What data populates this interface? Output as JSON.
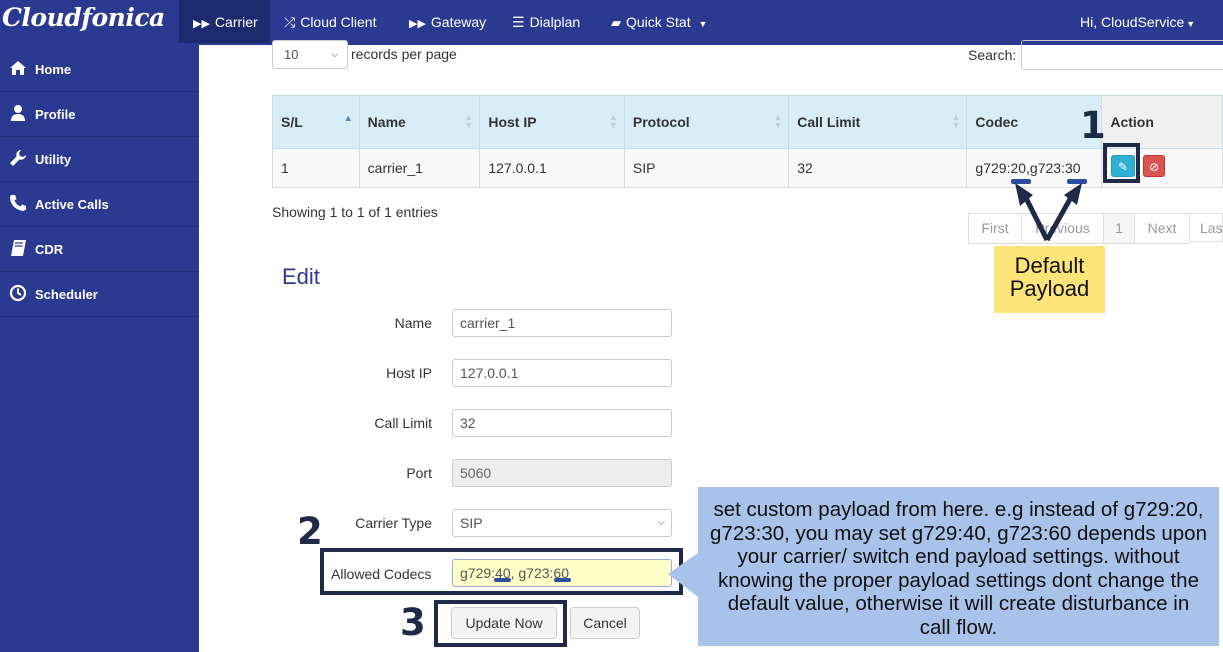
{
  "brand": "Cloudfonica",
  "nav": {
    "items": [
      {
        "label": "Carrier",
        "icon": "double-chevron-right-icon"
      },
      {
        "label": "Cloud Client",
        "icon": "shuffle-icon"
      },
      {
        "label": "Gateway",
        "icon": "double-chevron-right-icon"
      },
      {
        "label": "Dialplan",
        "icon": "list-icon"
      },
      {
        "label": "Quick Stat",
        "icon": "book-icon"
      }
    ],
    "user": "Hi, CloudService"
  },
  "sidebar": {
    "items": [
      {
        "label": "Home",
        "icon": "home-icon"
      },
      {
        "label": "Profile",
        "icon": "user-icon"
      },
      {
        "label": "Utility",
        "icon": "wrench-icon"
      },
      {
        "label": "Active Calls",
        "icon": "phone-icon"
      },
      {
        "label": "CDR",
        "icon": "book-icon"
      },
      {
        "label": "Scheduler",
        "icon": "clock-icon"
      }
    ]
  },
  "table_controls": {
    "page_size": "10",
    "records_per_page": "records per page",
    "search_label": "Search:",
    "search_value": ""
  },
  "table": {
    "headers": [
      "S/L",
      "Name",
      "Host IP",
      "Protocol",
      "Call Limit",
      "Codec",
      "Action"
    ],
    "rows": [
      {
        "sl": "1",
        "name": "carrier_1",
        "host_ip": "127.0.0.1",
        "protocol": "SIP",
        "call_limit": "32",
        "codec": "g729:20,g723:30"
      }
    ],
    "info": "Showing 1 to 1 of 1 entries"
  },
  "pagination": {
    "first": "First",
    "previous": "Previous",
    "current": "1",
    "next": "Next",
    "last": "Last"
  },
  "edit": {
    "title": "Edit",
    "name_label": "Name",
    "name_value": "carrier_1",
    "host_label": "Host IP",
    "host_value": "127.0.0.1",
    "limit_label": "Call Limit",
    "limit_value": "32",
    "port_label": "Port",
    "port_value": "5060",
    "type_label": "Carrier Type",
    "type_value": "SIP",
    "codecs_label": "Allowed Codecs",
    "codecs_value": "g729:40, g723:60",
    "update_label": "Update Now",
    "cancel_label": "Cancel"
  },
  "annotations": {
    "marker1": "1",
    "marker2": "2",
    "marker3": "3",
    "default_line1": "Default",
    "default_line2": "Payload",
    "callout": "set custom payload from here. e.g instead of g729:20, g723:30, you may set g729:40, g723:60 depends upon your carrier/ switch end payload settings. without knowing the proper payload settings dont change the default value, otherwise it will create disturbance in call flow.",
    "colors": {
      "marker_frame": "#1e2a46",
      "callout_bg": "#a9c2ea",
      "note_bg": "#ffe47a",
      "dash": "#2b4fa0"
    }
  }
}
